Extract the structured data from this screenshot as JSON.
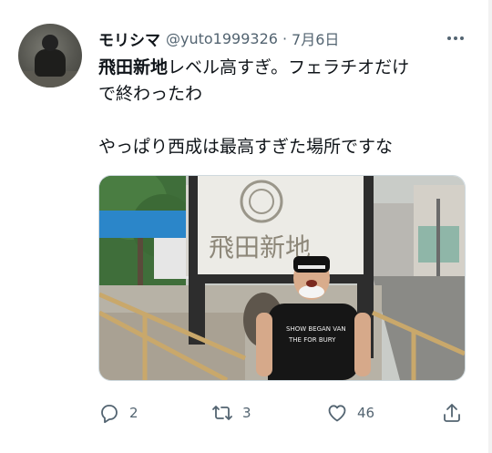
{
  "tweet": {
    "author": {
      "display_name": "モリシマ",
      "handle": "@yuto1999326",
      "separator": "·",
      "date": "7月6日"
    },
    "menu_icon": "more-horizontal-icon",
    "text": {
      "bold_lead": "飛田新地",
      "line1_rest": "レベル高すぎ。フェラチオだけ",
      "line2": "で終わったわ",
      "line3": "やっぱり西成は最高すぎた場所ですな"
    },
    "media": {
      "sign_text": "飛田新地",
      "shirt_text_1": "SHOW BEGAN VAN",
      "shirt_text_2": "THE FOR BURY"
    },
    "actions": {
      "reply": {
        "icon": "reply-icon",
        "count": "2"
      },
      "retweet": {
        "icon": "retweet-icon",
        "count": "3"
      },
      "like": {
        "icon": "heart-icon",
        "count": "46"
      },
      "share": {
        "icon": "share-icon",
        "count": ""
      }
    },
    "colors": {
      "text": "#0f1419",
      "muted": "#536471",
      "border": "#cfd9de"
    }
  }
}
